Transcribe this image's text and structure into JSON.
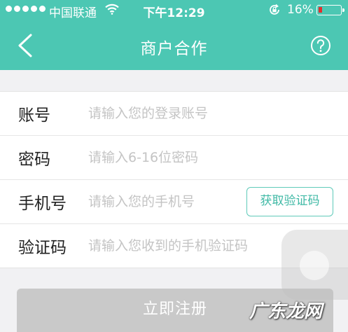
{
  "status_bar": {
    "carrier": "中国联通",
    "time": "下午12:29",
    "battery_percent": "16%",
    "battery_level": 0.16,
    "signal_bars": 5,
    "battery_color": "#e52d2d"
  },
  "nav": {
    "title": "商户合作",
    "back_icon": "chevron-left-icon",
    "help_icon": "question-circle-icon"
  },
  "form": {
    "account": {
      "label": "账号",
      "placeholder": "请输入您的登录账号"
    },
    "password": {
      "label": "密码",
      "placeholder": "请输入6-16位密码"
    },
    "phone": {
      "label": "手机号",
      "placeholder": "请输入您的手机号"
    },
    "get_code_button": "获取验证码",
    "code": {
      "label": "验证码",
      "placeholder": "请输入您收到的手机验证码"
    }
  },
  "submit_button": "立即注册",
  "watermark": "广东龙网",
  "colors": {
    "accent": "#4cc7b3",
    "button_disabled": "#c9c9c9",
    "background": "#f1f1f3"
  }
}
